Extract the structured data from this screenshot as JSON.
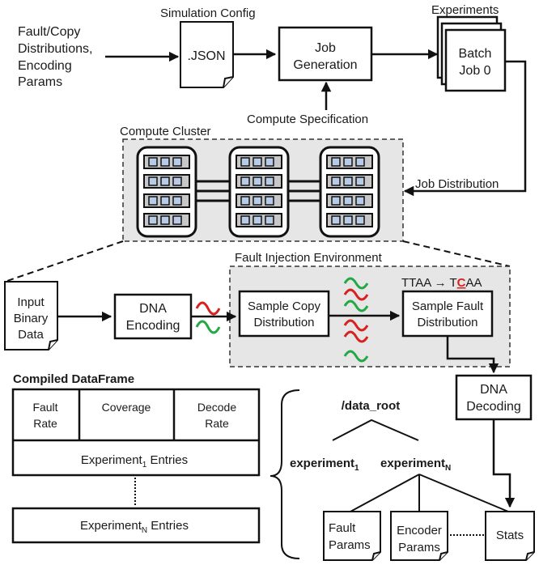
{
  "inputs": {
    "params_label": [
      "Fault/Copy",
      "Distributions,",
      "Encoding",
      "Params"
    ],
    "sim_config_label": "Simulation Config",
    "json_file": ".JSON",
    "job_generation": [
      "Job",
      "Generation"
    ],
    "compute_spec_label": "Compute Specification",
    "experiments_label": "Experiments",
    "batch_job": [
      "Batch",
      "Job 0"
    ],
    "job_distribution_label": "Job Distribution"
  },
  "cluster": {
    "title": "Compute Cluster",
    "rack_count": 3,
    "slots_per_rack": 4,
    "leds_per_slot": 3
  },
  "pipeline": {
    "input_file": [
      "Input",
      "Binary",
      "Data"
    ],
    "dna_encoding": [
      "DNA",
      "Encoding"
    ],
    "fault_env_title": "Fault Injection Environment",
    "sample_copy": [
      "Sample Copy",
      "Distribution"
    ],
    "sample_fault": [
      "Sample Fault",
      "Distribution"
    ],
    "mutation_example": {
      "before": "TTAA",
      "arrow": "→",
      "after_prefix": "T",
      "mutated_base": "C",
      "after_suffix": "AA"
    },
    "dna_decoding": [
      "DNA",
      "Decoding"
    ],
    "strand_colors": {
      "red": "#d9201f",
      "green": "#22a845"
    }
  },
  "dataframe": {
    "title": "Compiled DataFrame",
    "columns": [
      [
        "Fault",
        "Rate"
      ],
      [
        "Coverage"
      ],
      [
        "Decode",
        "Rate"
      ]
    ],
    "row_first": {
      "prefix": "Experiment",
      "sub": "1",
      "suffix": " Entries"
    },
    "row_last": {
      "prefix": "Experiment",
      "sub": "N",
      "suffix": " Entries"
    }
  },
  "tree": {
    "root": "/data_root",
    "exp_first": {
      "prefix": "experiment",
      "sub": "1"
    },
    "exp_last": {
      "prefix": "experiment",
      "sub": "N"
    },
    "leaves": {
      "fault_params": [
        "Fault",
        "Params"
      ],
      "encoder_params": [
        "Encoder",
        "Params"
      ],
      "stats": "Stats"
    }
  }
}
